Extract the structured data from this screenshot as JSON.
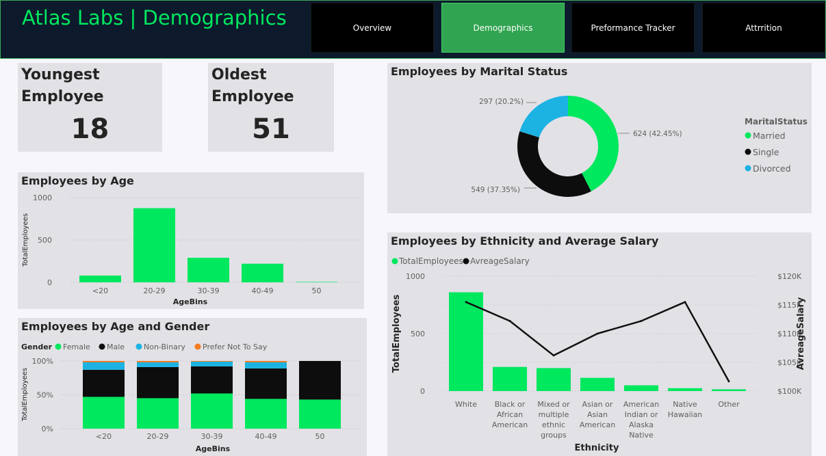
{
  "header": {
    "title": "Atlas Labs | Demographics",
    "tabs": [
      "Overview",
      "Demographics",
      "Preformance Tracker",
      "Attrrition"
    ],
    "active_tab": 1
  },
  "colors": {
    "green": "#00e85e",
    "black": "#0d0d0d",
    "blue": "#1cb3e3",
    "orange": "#f47b20",
    "nav_active": "#31a451"
  },
  "kpis": {
    "youngest": {
      "label_line1": "Youngest",
      "label_line2": "Employee",
      "value": "18"
    },
    "oldest": {
      "label_line1": "Oldest",
      "label_line2": "Employee",
      "value": "51"
    }
  },
  "chart_data": [
    {
      "id": "age",
      "type": "bar",
      "title": "Employees by Age",
      "xlabel": "AgeBins",
      "ylabel": "TotalEmployees",
      "categories": [
        "<20",
        "20-29",
        "30-39",
        "40-49",
        "50"
      ],
      "values": [
        80,
        875,
        290,
        220,
        5
      ],
      "ylim": [
        0,
        1000
      ],
      "yticks": [
        0,
        500,
        1000
      ]
    },
    {
      "id": "age_gender",
      "type": "bar",
      "stacked": "percent",
      "title": "Employees by Age and Gender",
      "xlabel": "AgeBins",
      "ylabel": "TotalEmployees",
      "legend_title": "Gender",
      "categories": [
        "<20",
        "20-29",
        "30-39",
        "40-49",
        "50"
      ],
      "series": [
        {
          "name": "Female",
          "values": [
            47,
            45,
            52,
            44,
            43
          ]
        },
        {
          "name": "Male",
          "values": [
            40,
            46,
            40,
            45,
            57
          ]
        },
        {
          "name": "Non-Binary",
          "values": [
            11,
            7,
            7,
            9,
            0
          ]
        },
        {
          "name": "Prefer Not To Say",
          "values": [
            2,
            2,
            1,
            2,
            0
          ]
        }
      ],
      "yticks": [
        "0%",
        "50%",
        "100%"
      ]
    },
    {
      "id": "marital",
      "type": "pie",
      "donut": true,
      "title": "Employees by Marital Status",
      "legend_title": "MaritalStatus",
      "slices": [
        {
          "name": "Married",
          "value": 624,
          "label": "624 (42.45%)"
        },
        {
          "name": "Single",
          "value": 549,
          "label": "549 (37.35%)"
        },
        {
          "name": "Divorced",
          "value": 297,
          "label": "297 (20.2%)"
        }
      ]
    },
    {
      "id": "ethnicity",
      "type": "bar",
      "combo_line": true,
      "title": "Employees by Ethnicity and Average Salary",
      "xlabel": "Ethnicity",
      "ylabel": "TotalEmployees",
      "y2label": "AvreageSalary",
      "legend": [
        "TotalEmployees",
        "AvreageSalary"
      ],
      "categories": [
        [
          "White"
        ],
        [
          "Black or",
          "African",
          "American"
        ],
        [
          "Mixed or",
          "multiple",
          "ethnic",
          "groups"
        ],
        [
          "Asian or",
          "Asian",
          "American"
        ],
        [
          "American",
          "Indian or",
          "Alaska",
          "Native"
        ],
        [
          "Native",
          "Hawaiian"
        ],
        [
          "Other"
        ]
      ],
      "series": [
        {
          "name": "TotalEmployees",
          "values": [
            860,
            210,
            200,
            115,
            50,
            25,
            15
          ]
        },
        {
          "name": "AvreageSalary",
          "values": [
            115500,
            112200,
            106200,
            110000,
            112200,
            115500,
            101700
          ]
        }
      ],
      "ylim": [
        0,
        1000
      ],
      "yticks": [
        0,
        500,
        1000
      ],
      "y2lim": [
        100000,
        120000
      ],
      "y2ticks": [
        "$100K",
        "$105K",
        "$110K",
        "$115K",
        "$120K"
      ]
    }
  ]
}
